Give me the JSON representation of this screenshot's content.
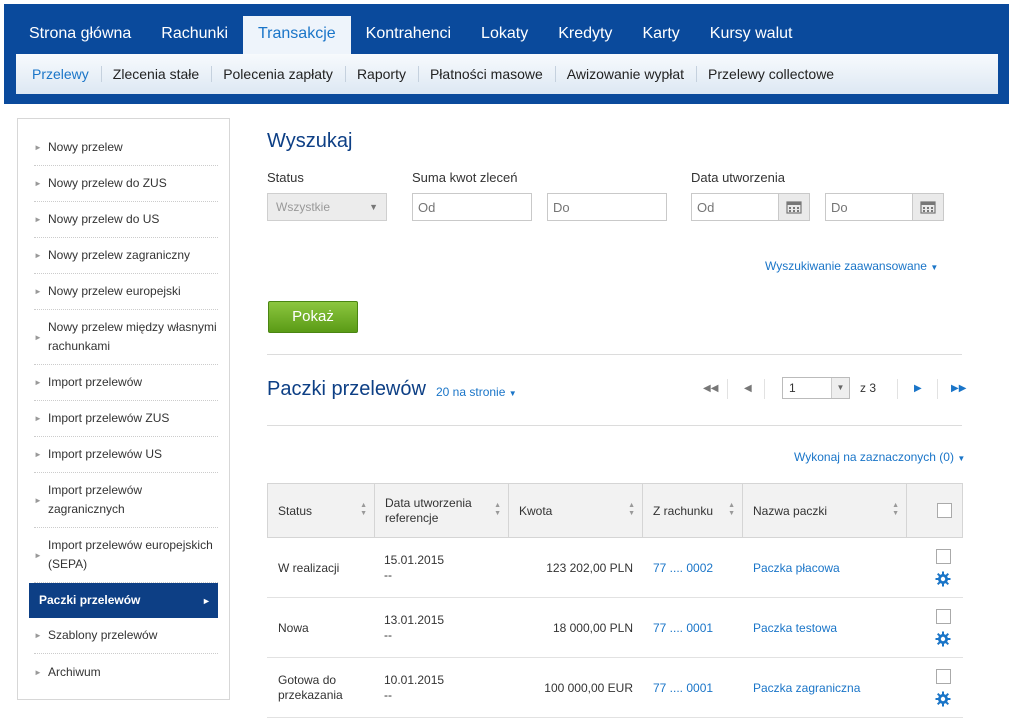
{
  "topnav": {
    "tabs": [
      "Strona główna",
      "Rachunki",
      "Transakcje",
      "Kontrahenci",
      "Lokaty",
      "Kredyty",
      "Karty",
      "Kursy walut"
    ],
    "active_tab": "Transakcje",
    "subtabs": [
      "Przelewy",
      "Zlecenia stałe",
      "Polecenia zapłaty",
      "Raporty",
      "Płatności masowe",
      "Awizowanie wypłat",
      "Przelewy collectowe"
    ],
    "active_subtab": "Przelewy"
  },
  "sidebar": {
    "items": [
      {
        "label": "Nowy przelew"
      },
      {
        "label": "Nowy przelew do ZUS"
      },
      {
        "label": "Nowy przelew do US"
      },
      {
        "label": "Nowy przelew zagraniczny"
      },
      {
        "label": "Nowy przelew europejski"
      },
      {
        "label": "Nowy przelew między własnymi rachunkami"
      },
      {
        "label": "Import przelewów"
      },
      {
        "label": "Import przelewów ZUS"
      },
      {
        "label": "Import przelewów US"
      },
      {
        "label": "Import przelewów zagranicznych"
      },
      {
        "label": "Import przelewów europejskich (SEPA)"
      },
      {
        "label": "Paczki przelewów"
      },
      {
        "label": "Szablony przelewów"
      },
      {
        "label": "Archiwum"
      }
    ],
    "active": "Paczki przelewów"
  },
  "search": {
    "title": "Wyszukaj",
    "status_label": "Status",
    "status_value": "Wszystkie",
    "amount_label": "Suma kwot zleceń",
    "amount_from_placeholder": "Od",
    "amount_to_placeholder": "Do",
    "date_label": "Data utworzenia",
    "date_from_placeholder": "Od",
    "date_to_placeholder": "Do",
    "advanced_label": "Wyszukiwanie zaawansowane",
    "show_button": "Pokaż"
  },
  "packages": {
    "title": "Paczki przelewów",
    "per_page": "20 na stronie",
    "page": "1",
    "of_label": "z 3",
    "bulk_action": "Wykonaj na zaznaczonych (0)",
    "columns": {
      "status": "Status",
      "date_line1": "Data utworzenia",
      "date_line2": "referencje",
      "amount": "Kwota",
      "account": "Z rachunku",
      "name": "Nazwa paczki"
    },
    "rows": [
      {
        "status": "W realizacji",
        "date": "15.01.2015",
        "reference": "--",
        "amount": "123 202,00 PLN",
        "account": "77 .... 0002",
        "name": "Paczka płacowa"
      },
      {
        "status": "Nowa",
        "date": "13.01.2015",
        "reference": "--",
        "amount": "18 000,00 PLN",
        "account": "77 .... 0001",
        "name": "Paczka testowa"
      },
      {
        "status": "Gotowa do przekazania",
        "date": "10.01.2015",
        "reference": "--",
        "amount": "100 000,00 EUR",
        "account": "77 .... 0001",
        "name": "Paczka zagraniczna"
      }
    ]
  },
  "colors": {
    "brand_blue": "#0a4a9c",
    "link_blue": "#1a75c8",
    "button_green": "#6aab22"
  }
}
